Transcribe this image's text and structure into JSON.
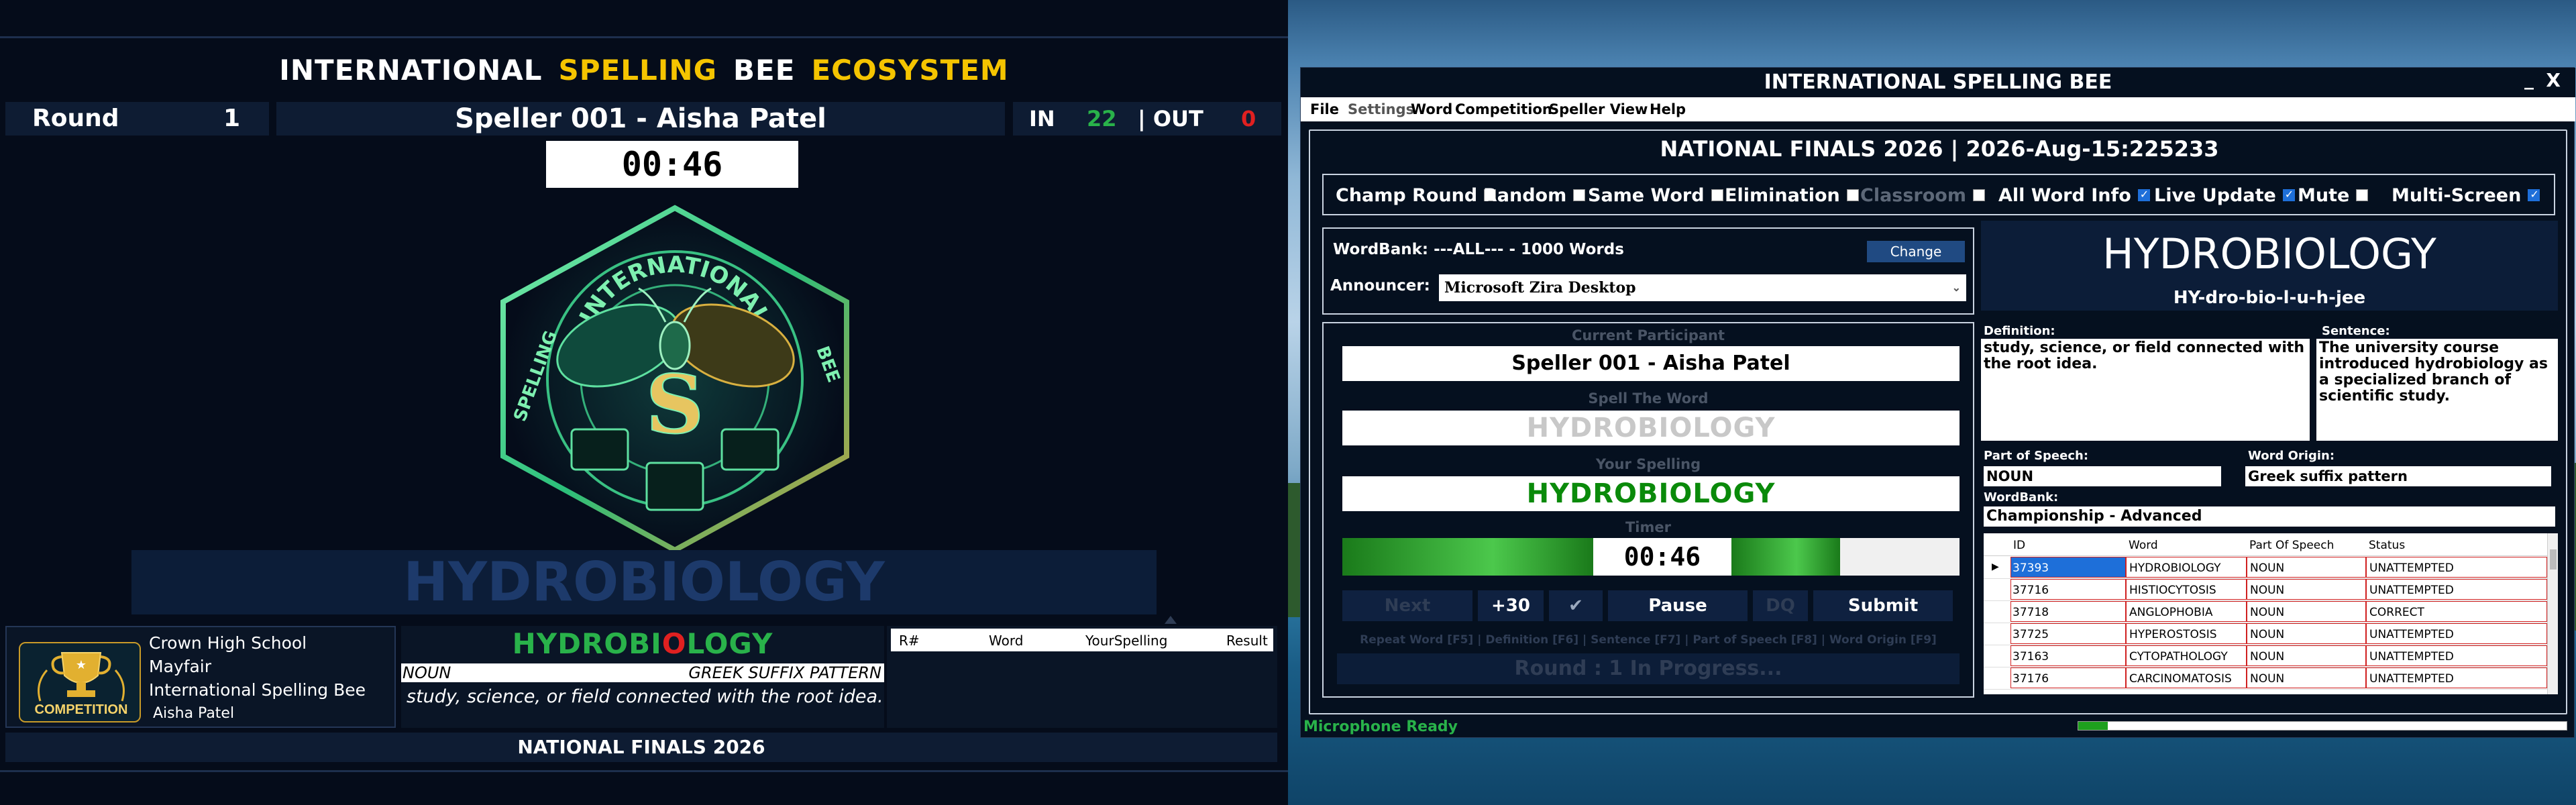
{
  "left_display": {
    "title_parts": [
      "INTERNATIONAL",
      "SPELLING",
      "BEE",
      "ECOSYSTEM"
    ],
    "round_label": "Round",
    "round_value": "1",
    "speller": "Speller 001 - Aisha Patel",
    "in_label": "IN",
    "in_value": "22",
    "out_label": "| OUT",
    "out_value": "0",
    "timer": "00:46",
    "logo_text": [
      "INTERNATIONAL",
      "SPELLING",
      "BEE"
    ],
    "word_banner": "HYDROBIOLOGY",
    "badge_text": "COMPETITION",
    "school_lines": [
      "Crown High School",
      "Mayfair",
      "International Spelling Bee",
      "Aisha Patel"
    ],
    "typed_word_parts": [
      "HYDROBI",
      "O",
      "LOGY"
    ],
    "part_of_speech": "NOUN",
    "origin": "GREEK SUFFIX PATTERN",
    "definition": "study, science, or field connected with the root idea.",
    "results_headers": [
      "R#",
      "Word",
      "YourSpelling",
      "Result"
    ],
    "footer": "NATIONAL FINALS 2026"
  },
  "app": {
    "title": "INTERNATIONAL SPELLING BEE",
    "min_glyph": "_",
    "close_glyph": "X",
    "menu": [
      "File",
      "Settings",
      "Word",
      "Competition",
      "Speller View",
      "Help"
    ],
    "event_title": "NATIONAL FINALS 2026 | 2026-Aug-15:225233",
    "options": [
      {
        "label": "Champ Round",
        "checked": false
      },
      {
        "label": "Random",
        "checked": false
      },
      {
        "label": "Same Word",
        "checked": false
      },
      {
        "label": "Elimination",
        "checked": false
      },
      {
        "label": "Classroom",
        "checked": false,
        "disabled": true
      },
      {
        "label": "All Word Info",
        "checked": true
      },
      {
        "label": "Live Update",
        "checked": true
      },
      {
        "label": "Mute",
        "checked": false
      },
      {
        "label": "Multi-Screen",
        "checked": true
      }
    ],
    "wordbank_text": "WordBank: ---ALL--- - 1000 Words",
    "change_label": "Change",
    "announcer_label": "Announcer:",
    "announcer_value": "Microsoft Zira Desktop",
    "current_participant_label": "Current Participant",
    "current_participant": "Speller 001 - Aisha Patel",
    "spell_word_label": "Spell The Word",
    "spell_word": "HYDROBIOLOGY",
    "your_spelling_label": "Your Spelling",
    "your_spelling": "HYDROBIOLOGY",
    "timer_label": "Timer",
    "timer": "00:46",
    "buttons": {
      "next": "Next",
      "plus30": "+30",
      "check": "✔",
      "pause": "Pause",
      "dq": "DQ",
      "submit": "Submit"
    },
    "hotkeys": "Repeat Word [F5] | Definition [F6] | Sentence [F7] | Part of Speech [F8] | Word Origin [F9]",
    "round_progress": "Round :  1 In Progress...",
    "word": "HYDROBIOLOGY",
    "phonetic": "HY-dro-bio-l-u-h-jee",
    "definition_label": "Definition:",
    "definition": "study, science, or field connected with the root idea.",
    "sentence_label": "Sentence:",
    "sentence": "The university course introduced hydrobiology as a specialized branch of scientific study.",
    "pos_label": "Part of Speech:",
    "pos": "NOUN",
    "origin_label": "Word Origin:",
    "origin": "Greek suffix pattern",
    "wordbank_label": "WordBank:",
    "wordbank": "Championship - Advanced",
    "grid_headers": [
      "ID",
      "Word",
      "Part Of Speech",
      "Status"
    ],
    "grid_rows": [
      {
        "id": "37393",
        "word": "HYDROBIOLOGY",
        "pos": "NOUN",
        "status": "UNATTEMPTED"
      },
      {
        "id": "37716",
        "word": "HISTIOCYTOSIS",
        "pos": "NOUN",
        "status": "UNATTEMPTED"
      },
      {
        "id": "37718",
        "word": "ANGLOPHOBIA",
        "pos": "NOUN",
        "status": "CORRECT"
      },
      {
        "id": "37725",
        "word": "HYPEROSTOSIS",
        "pos": "NOUN",
        "status": "UNATTEMPTED"
      },
      {
        "id": "37163",
        "word": "CYTOPATHOLOGY",
        "pos": "NOUN",
        "status": "UNATTEMPTED"
      },
      {
        "id": "37176",
        "word": "CARCINOMATOSIS",
        "pos": "NOUN",
        "status": "UNATTEMPTED"
      }
    ],
    "mic_status": "Microphone Ready",
    "mic_level": 0.06
  },
  "colors": {
    "accent_yellow": "#f5c400",
    "green": "#29b24a",
    "red": "#e02020",
    "panel": "#0c1d38"
  }
}
